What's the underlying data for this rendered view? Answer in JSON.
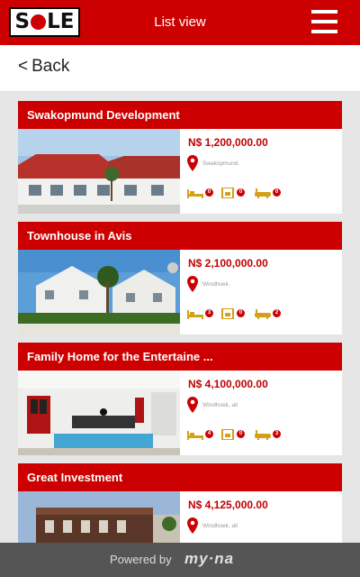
{
  "header": {
    "logo_text": "SOLE",
    "title": "List view"
  },
  "nav": {
    "back_label": "Back"
  },
  "listings": [
    {
      "title": "Swakopmund Development",
      "price": "N$ 1,200,000.00",
      "location": "Swakopmund.",
      "beds": "0",
      "garages": "0",
      "baths": "0"
    },
    {
      "title": "Townhouse in Avis",
      "price": "N$ 2,100,000.00",
      "location": "Windhoek.",
      "beds": "3",
      "garages": "0",
      "baths": "2"
    },
    {
      "title": "Family Home for the Entertaine ...",
      "price": "N$ 4,100,000.00",
      "location": "Windhoek, all",
      "beds": "4",
      "garages": "0",
      "baths": "3"
    },
    {
      "title": "Great Investment",
      "price": "N$ 4,125,000.00",
      "location": "Windhoek, all",
      "beds": "",
      "garages": "",
      "baths": ""
    }
  ],
  "footer": {
    "powered_by": "Powered by",
    "brand": "my·na"
  },
  "colors": {
    "accent": "#cc0000",
    "footer": "#555555",
    "background": "#e6e6e6",
    "icon_gold": "#d4a017"
  }
}
